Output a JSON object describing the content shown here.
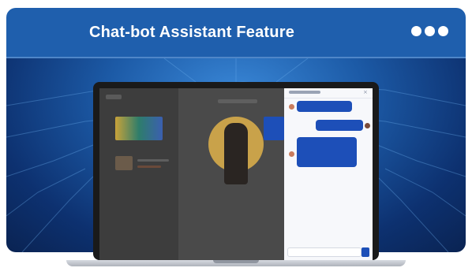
{
  "header": {
    "title": "Chat-bot Assistant Feature",
    "menu_icon": "more-dots-icon"
  },
  "colors": {
    "header_bg": "#1f5fad",
    "accent": "#1d4fb8",
    "background": "#0d3170"
  }
}
